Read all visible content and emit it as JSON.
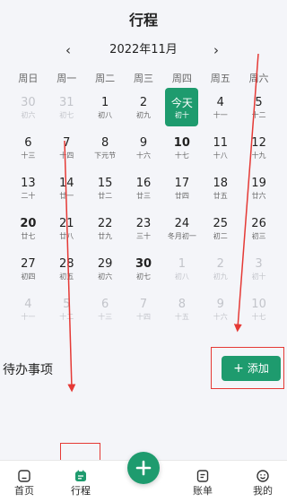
{
  "header": {
    "title": "行程"
  },
  "month_nav": {
    "prev": "‹",
    "label": "2022年11月",
    "next": "›"
  },
  "weekdays": [
    "周日",
    "周一",
    "周二",
    "周三",
    "周四",
    "周五",
    "周六"
  ],
  "calendar": [
    {
      "num": "30",
      "lunar": "初六",
      "muted": true
    },
    {
      "num": "31",
      "lunar": "初七",
      "muted": true
    },
    {
      "num": "1",
      "lunar": "初八"
    },
    {
      "num": "2",
      "lunar": "初九"
    },
    {
      "num": "今天",
      "lunar": "初十",
      "today": true
    },
    {
      "num": "4",
      "lunar": "十一"
    },
    {
      "num": "5",
      "lunar": "十二"
    },
    {
      "num": "6",
      "lunar": "十三"
    },
    {
      "num": "7",
      "lunar": "十四"
    },
    {
      "num": "8",
      "lunar": "下元节"
    },
    {
      "num": "9",
      "lunar": "十六"
    },
    {
      "num": "10",
      "lunar": "十七",
      "bold": true
    },
    {
      "num": "11",
      "lunar": "十八"
    },
    {
      "num": "12",
      "lunar": "十九"
    },
    {
      "num": "13",
      "lunar": "二十"
    },
    {
      "num": "14",
      "lunar": "廿一"
    },
    {
      "num": "15",
      "lunar": "廿二"
    },
    {
      "num": "16",
      "lunar": "廿三"
    },
    {
      "num": "17",
      "lunar": "廿四"
    },
    {
      "num": "18",
      "lunar": "廿五"
    },
    {
      "num": "19",
      "lunar": "廿六"
    },
    {
      "num": "20",
      "lunar": "廿七",
      "bold": true
    },
    {
      "num": "21",
      "lunar": "廿八"
    },
    {
      "num": "22",
      "lunar": "廿九"
    },
    {
      "num": "23",
      "lunar": "三十"
    },
    {
      "num": "24",
      "lunar": "冬月初一"
    },
    {
      "num": "25",
      "lunar": "初二"
    },
    {
      "num": "26",
      "lunar": "初三"
    },
    {
      "num": "27",
      "lunar": "初四"
    },
    {
      "num": "28",
      "lunar": "初五"
    },
    {
      "num": "29",
      "lunar": "初六"
    },
    {
      "num": "30",
      "lunar": "初七",
      "bold": true
    },
    {
      "num": "1",
      "lunar": "初八",
      "muted": true
    },
    {
      "num": "2",
      "lunar": "初九",
      "muted": true
    },
    {
      "num": "3",
      "lunar": "初十",
      "muted": true
    },
    {
      "num": "4",
      "lunar": "十一",
      "muted": true
    },
    {
      "num": "5",
      "lunar": "十二",
      "muted": true
    },
    {
      "num": "6",
      "lunar": "十三",
      "muted": true
    },
    {
      "num": "7",
      "lunar": "十四",
      "muted": true
    },
    {
      "num": "8",
      "lunar": "十五",
      "muted": true
    },
    {
      "num": "9",
      "lunar": "十六",
      "muted": true
    },
    {
      "num": "10",
      "lunar": "十七",
      "muted": true
    }
  ],
  "todo": {
    "title": "待办事项",
    "add_label": "添加",
    "add_icon": "plus-icon"
  },
  "tabbar": {
    "home": {
      "label": "首页",
      "icon": "home-icon"
    },
    "schedule": {
      "label": "行程",
      "icon": "calendar-icon"
    },
    "fab_icon": "plus-icon",
    "bills": {
      "label": "账单",
      "icon": "bill-icon"
    },
    "me": {
      "label": "我的",
      "icon": "smiley-icon"
    }
  },
  "colors": {
    "accent": "#1e9b6e",
    "annotation": "#e53935",
    "muted": "#c2c4ca",
    "background": "#f4f5f9"
  }
}
